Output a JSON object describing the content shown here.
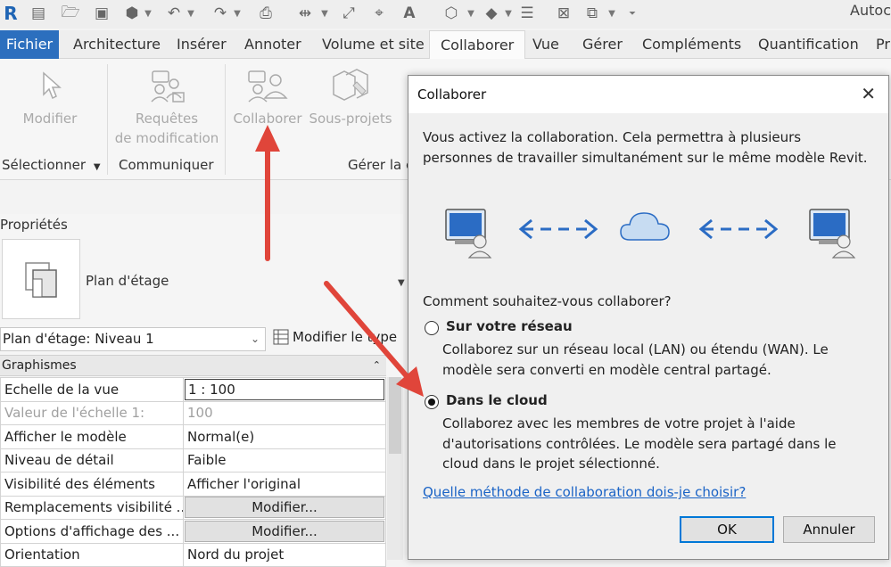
{
  "app_title": "Autoc",
  "ribbon_tabs": [
    "Fichier",
    "Architecture",
    "Insérer",
    "Annoter",
    "Volume et site",
    "Collaborer",
    "Vue",
    "Gérer",
    "Compléments",
    "Quantification",
    "Pr"
  ],
  "ribbon": {
    "modify_label": "Modifier",
    "requests_line1": "Requêtes",
    "requests_line2": "de modification",
    "collaborate_label": "Collaborer",
    "worksets_label": "Sous-projets",
    "panel_select": "Sélectionner",
    "panel_communicate": "Communiquer",
    "panel_manage": "Gérer la c"
  },
  "properties": {
    "title": "Propriétés",
    "type_name": "Plan d'étage",
    "instance_selector": "Plan d'étage: Niveau 1",
    "edit_type": "Modifier le type",
    "group": "Graphismes",
    "rows": [
      {
        "key": "Echelle de la vue",
        "value": "1 : 100"
      },
      {
        "key": "Valeur de l'échelle    1:",
        "value": "100"
      },
      {
        "key": "Afficher le modèle",
        "value": "Normal(e)"
      },
      {
        "key": "Niveau de détail",
        "value": "Faible"
      },
      {
        "key": "Visibilité des éléments",
        "value": "Afficher l'original"
      },
      {
        "key": "Remplacements visibilité ...",
        "value": "Modifier..."
      },
      {
        "key": "Options d'affichage des ...",
        "value": "Modifier..."
      },
      {
        "key": "Orientation",
        "value": "Nord du projet"
      }
    ]
  },
  "dialog": {
    "title": "Collaborer",
    "intro": "Vous activez la collaboration. Cela permettra à plusieurs personnes de travailler simultanément sur le même modèle Revit.",
    "question": "Comment souhaitez-vous collaborer?",
    "option_network_label": "Sur votre réseau",
    "option_network_desc": "Collaborez sur un réseau local (LAN) ou étendu (WAN). Le modèle sera converti en modèle central partagé.",
    "option_cloud_label": "Dans le cloud",
    "option_cloud_desc": "Collaborez avec les membres de votre projet à l'aide d'autorisations contrôlées. Le modèle sera partagé dans le cloud dans le projet sélectionné.",
    "selected_option": "cloud",
    "help_link": "Quelle méthode de collaboration dois-je choisir?",
    "ok_label": "OK",
    "cancel_label": "Annuler"
  },
  "colors": {
    "file_tab": "#2c6fbe",
    "link": "#1a63c6",
    "annotation_arrow": "#e0453a",
    "illustration_blue": "#2b6cc4"
  }
}
